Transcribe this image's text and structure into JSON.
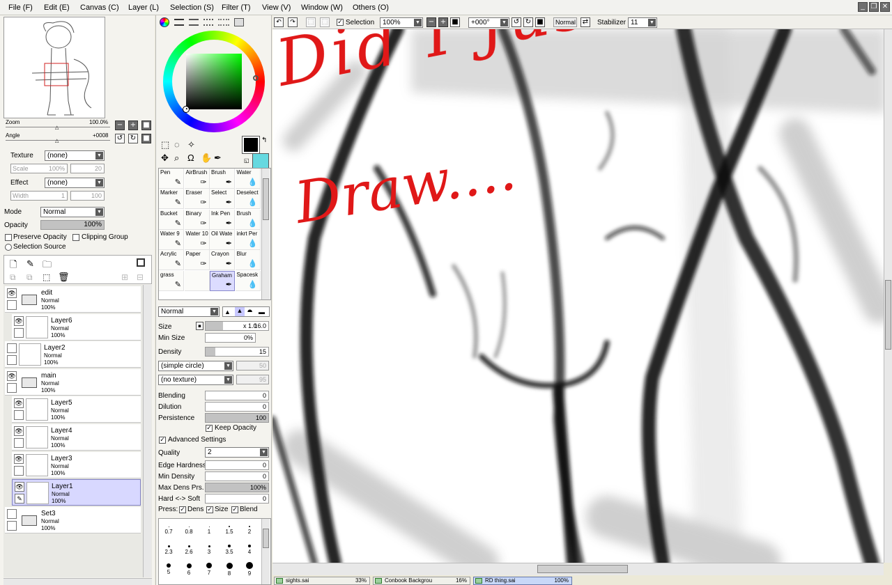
{
  "menu": [
    "File (F)",
    "Edit (E)",
    "Canvas (C)",
    "Layer (L)",
    "Selection (S)",
    "Filter (T)",
    "View (V)",
    "Window (W)",
    "Others (O)"
  ],
  "navigator": {
    "zoom_label": "Zoom",
    "zoom_value": "100.0%",
    "angle_label": "Angle",
    "angle_value": "+0008"
  },
  "texture": {
    "label": "Texture",
    "value": "(none)",
    "scale_label": "Scale",
    "scale_value": "100%",
    "scale_num": "20"
  },
  "effect": {
    "label": "Effect",
    "value": "(none)",
    "width_label": "Width",
    "width_value": "1",
    "width_num": "100"
  },
  "layer_props": {
    "mode_label": "Mode",
    "mode_value": "Normal",
    "opacity_label": "Opacity",
    "opacity_value": "100%",
    "preserve_opacity": "Preserve Opacity",
    "clipping_group": "Clipping Group",
    "selection_source": "Selection Source"
  },
  "layers": [
    {
      "name": "edit",
      "mode": "Normal",
      "opacity": "100%",
      "folder": true,
      "visible": true
    },
    {
      "name": "Layer6",
      "mode": "Normal",
      "opacity": "100%",
      "folder": false,
      "visible": true
    },
    {
      "name": "Layer2",
      "mode": "Normal",
      "opacity": "100%",
      "folder": false,
      "visible": false
    },
    {
      "name": "main",
      "mode": "Normal",
      "opacity": "100%",
      "folder": true,
      "visible": true
    },
    {
      "name": "Layer5",
      "mode": "Normal",
      "opacity": "100%",
      "folder": false,
      "visible": true
    },
    {
      "name": "Layer4",
      "mode": "Normal",
      "opacity": "100%",
      "folder": false,
      "visible": true
    },
    {
      "name": "Layer3",
      "mode": "Normal",
      "opacity": "100%",
      "folder": false,
      "visible": true
    },
    {
      "name": "Layer1",
      "mode": "Normal",
      "opacity": "100%",
      "folder": false,
      "visible": true,
      "selected": true
    },
    {
      "name": "Set3",
      "mode": "Normal",
      "opacity": "100%",
      "folder": true,
      "visible": false
    }
  ],
  "colors": {
    "primary": "#000000",
    "secondary": "#66d9e0",
    "selected_layer": "#d8d8ff"
  },
  "brushes": [
    [
      "Pen",
      "AirBrush",
      "Brush",
      "Water"
    ],
    [
      "Marker",
      "Eraser",
      "Select",
      "Deselect"
    ],
    [
      "Bucket",
      "Binary",
      "Ink Pen",
      "Brush"
    ],
    [
      "Water 9",
      "Water 10",
      "Oil Wate",
      "inkrt Per"
    ],
    [
      "Acrylic",
      "Paper",
      "Crayon",
      "Blur"
    ],
    [
      "grass",
      "",
      "Graham",
      "Spacesk"
    ]
  ],
  "brush_settings": {
    "blend_mode": "Normal",
    "size_label": "Size",
    "size_mult": "x 1.0",
    "size_value": "16.0",
    "min_size_label": "Min Size",
    "min_size_value": "0%",
    "density_label": "Density",
    "density_value": "15",
    "shape": "(simple circle)",
    "shape_num": "50",
    "texture": "(no texture)",
    "texture_num": "95",
    "blending_label": "Blending",
    "blending_value": "0",
    "dilution_label": "Dilution",
    "dilution_value": "0",
    "persistence_label": "Persistence",
    "persistence_value": "100",
    "keep_opacity": "Keep Opacity",
    "advanced": "Advanced Settings",
    "quality_label": "Quality",
    "quality_value": "2",
    "edge_label": "Edge Hardness",
    "edge_value": "0",
    "min_density_label": "Min Density",
    "min_density_value": "0",
    "max_dens_label": "Max Dens Prs.",
    "max_dens_value": "100%",
    "hard_soft_label": "Hard <-> Soft",
    "hard_soft_value": "0",
    "press_label": "Press:",
    "press_dens": "Dens",
    "press_size": "Size",
    "press_blend": "Blend"
  },
  "brush_sizes": [
    [
      "0.7",
      "0.8",
      "1",
      "1.5",
      "2"
    ],
    [
      "2.3",
      "2.6",
      "3",
      "3.5",
      "4"
    ],
    [
      "5",
      "6",
      "7",
      "8",
      "9"
    ]
  ],
  "canvas_toolbar": {
    "selection": "Selection",
    "zoom": "100%",
    "angle": "+000°",
    "blend": "Normal",
    "stabilizer_label": "Stabilizer",
    "stabilizer_value": "11"
  },
  "canvas_text": [
    "Did I Just",
    "Draw...."
  ],
  "tabs": [
    {
      "name": "sights.sai",
      "pct": "33%"
    },
    {
      "name": "Conbook Backgrou",
      "pct": "16%"
    },
    {
      "name": "RD thing.sai",
      "pct": "100%"
    }
  ]
}
